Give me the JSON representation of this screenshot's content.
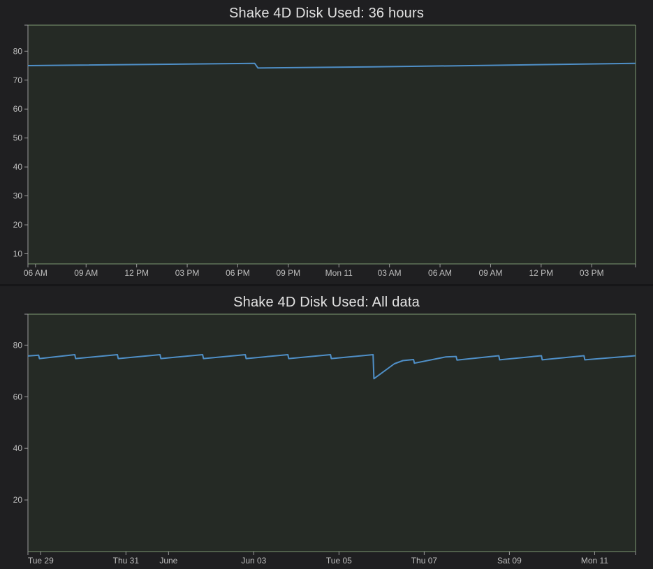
{
  "charts": [
    {
      "title": "Shake 4D Disk Used: 36 hours",
      "type": "line",
      "y_ticks": [
        10,
        20,
        30,
        40,
        50,
        60,
        70,
        80
      ],
      "ylim": [
        6.5,
        89
      ],
      "x_ticks": [
        "06 AM",
        "09 AM",
        "12 PM",
        "03 PM",
        "06 PM",
        "09 PM",
        "Mon 11",
        "03 AM",
        "06 AM",
        "09 AM",
        "12 PM",
        "03 PM"
      ],
      "x_tick_hours": [
        0,
        3,
        6,
        9,
        12,
        15,
        18,
        21,
        24,
        27,
        30,
        33
      ],
      "xlim_hours": [
        -0.45,
        35.6
      ],
      "series": [
        {
          "x": [
            -0.45,
            13.0,
            13.2,
            20.0,
            27.0,
            35.6
          ],
          "y": [
            75.0,
            75.8,
            74.2,
            74.6,
            75.1,
            75.8
          ]
        }
      ]
    },
    {
      "title": "Shake 4D Disk Used: All data",
      "type": "line",
      "y_ticks": [
        20,
        40,
        60,
        80
      ],
      "ylim": [
        0,
        92
      ],
      "x_ticks": [
        "Tue 29",
        "Thu 31",
        "June",
        "Jun 03",
        "Tue 05",
        "Thu 07",
        "Sat 09",
        "Mon 11"
      ],
      "x_tick_days": [
        0,
        2,
        3,
        5,
        7,
        9,
        11,
        13
      ],
      "xlim_days": [
        -0.3,
        13.96
      ],
      "series": [
        {
          "x": [
            -0.3,
            -0.05,
            -0.03,
            0.8,
            0.82,
            1.8,
            1.82,
            2.8,
            2.82,
            3.8,
            3.82,
            4.8,
            4.82,
            5.8,
            5.82,
            6.8,
            6.82,
            7.8,
            7.82,
            8.3,
            8.5,
            8.75,
            8.77,
            9.5,
            9.75,
            9.77,
            10.75,
            10.77,
            11.75,
            11.77,
            12.75,
            12.77,
            13.96
          ],
          "y": [
            75.8,
            76.1,
            74.8,
            76.3,
            74.8,
            76.3,
            74.8,
            76.3,
            74.8,
            76.3,
            74.8,
            76.3,
            74.8,
            76.3,
            74.8,
            76.3,
            74.8,
            76.3,
            67.0,
            72.8,
            74.0,
            74.4,
            73.0,
            75.4,
            75.6,
            74.2,
            75.9,
            74.3,
            75.9,
            74.3,
            75.9,
            74.3,
            75.9
          ]
        }
      ]
    }
  ],
  "colors": {
    "line": "#4f8fc7",
    "plot_bg": "#252a25",
    "plot_border": "#7e9a72",
    "axis": "#9a9a9a",
    "tick_text": "#bdbdbd"
  }
}
